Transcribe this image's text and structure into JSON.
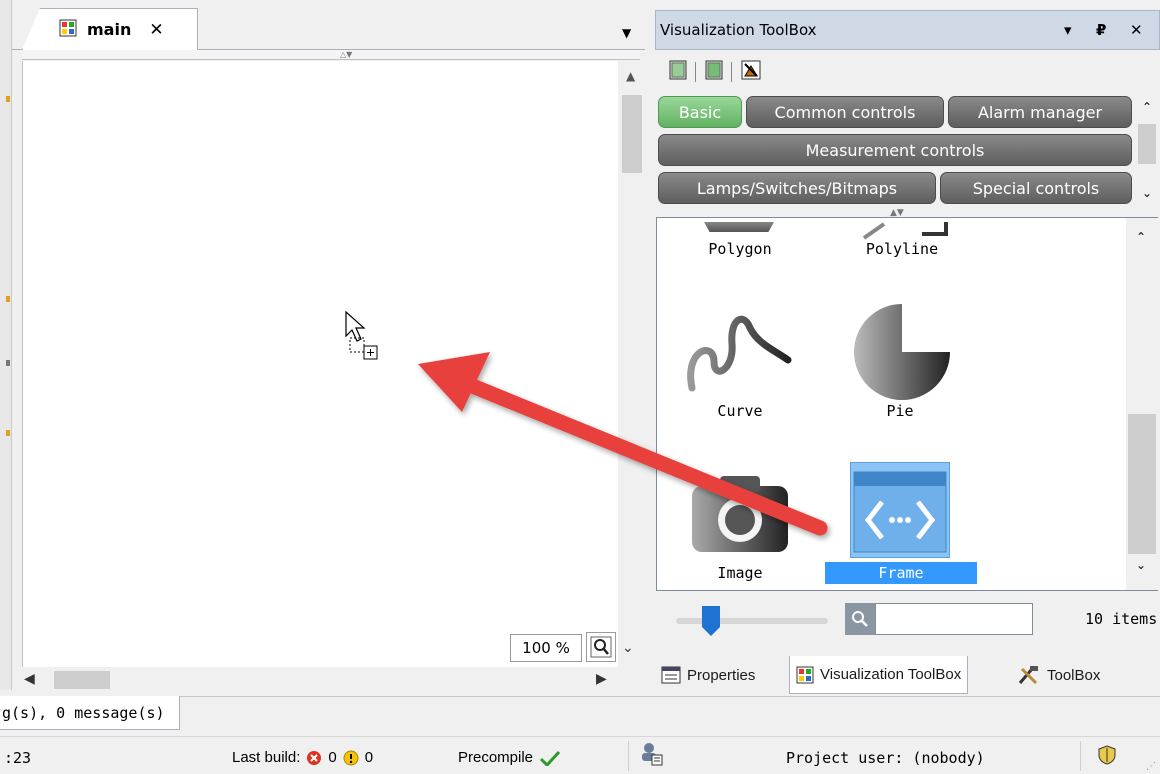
{
  "editor": {
    "tab_label": "main",
    "tab_close": "✕",
    "zoom_value": "100 %"
  },
  "messages": {
    "tab_label": "g(s), 0 message(s)"
  },
  "statusbar": {
    "left_number": ":23",
    "last_build_label": "Last build:",
    "errors": "0",
    "warnings": "0",
    "precompile_label": "Precompile",
    "project_user": "Project user: (nobody)"
  },
  "toolbox": {
    "title": "Visualization ToolBox",
    "title_controls": [
      "▾",
      "₽",
      "✕"
    ],
    "categories": {
      "basic": "Basic",
      "common": "Common controls",
      "alarm": "Alarm manager",
      "measurement": "Measurement controls",
      "lamps": "Lamps/Switches/Bitmaps",
      "special": "Special controls"
    },
    "items": {
      "polygon": "Polygon",
      "polyline": "Polyline",
      "curve": "Curve",
      "pie": "Pie",
      "image": "Image",
      "frame": "Frame"
    },
    "search_placeholder": "",
    "item_count": "10 items",
    "zoom_slider_fraction": 0.2
  },
  "panel_tabs": {
    "properties": "Properties",
    "visualization_toolbox": "Visualization ToolBox",
    "toolbox": "ToolBox"
  },
  "colors": {
    "active_category": "#62b162",
    "category": "#5e5e5e",
    "selection": "#3399ff",
    "annotation_arrow": "#e8413c"
  }
}
